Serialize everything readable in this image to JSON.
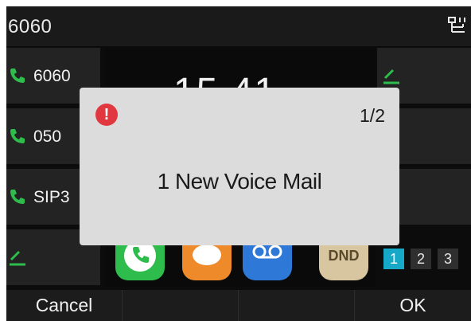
{
  "header": {
    "account": "6060",
    "network_icon": "network-icon"
  },
  "line_keys": [
    {
      "label": "6060",
      "icon": "phone-icon"
    },
    {
      "label": "050",
      "icon": "phone-icon"
    },
    {
      "label": "SIP3",
      "icon": "phone-icon"
    },
    {
      "label": "",
      "icon": "edit-icon"
    }
  ],
  "clock": {
    "time": "15 41"
  },
  "apps": [
    {
      "name": "call",
      "icon": "phone-icon",
      "color": "#2ebd4c"
    },
    {
      "name": "messages",
      "icon": "chat-bubble-icon",
      "color": "#ef8a2a"
    },
    {
      "name": "voicemail",
      "icon": "voicemail-icon",
      "color": "#2e79d8"
    },
    {
      "name": "dnd",
      "label": "DND",
      "color": "#d8c6a0"
    }
  ],
  "pages": [
    "1",
    "2",
    "3"
  ],
  "active_page": "1",
  "popup": {
    "counter": "1/2",
    "message": "1 New Voice Mail",
    "icon": "alert-icon"
  },
  "softkeys": {
    "left": "Cancel",
    "right": "OK"
  }
}
